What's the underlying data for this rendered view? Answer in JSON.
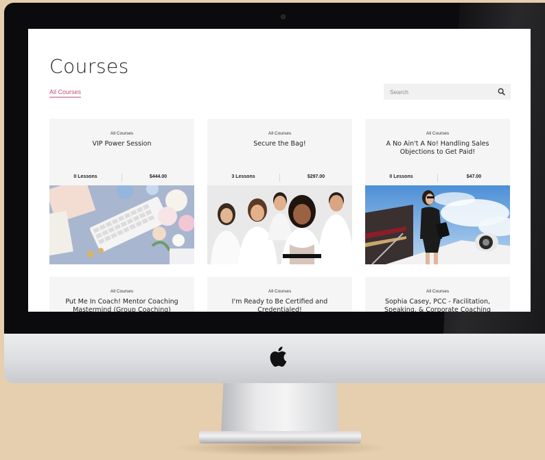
{
  "page": {
    "title": "Courses",
    "filter_tab": "All Courses",
    "search_placeholder": "Search"
  },
  "courses": [
    {
      "category": "All Courses",
      "title": "VIP Power Session",
      "lessons": "0 Lessons",
      "price": "$444.00",
      "image": "desk-flatlay-photo"
    },
    {
      "category": "All Courses",
      "title": "Secure the Bag!",
      "lessons": "3 Lessons",
      "price": "$297.00",
      "image": "team-group-photo"
    },
    {
      "category": "All Courses",
      "title": "A No Ain't A No! Handling Sales Objections to Get Paid!",
      "lessons": "0 Lessons",
      "price": "$47.00",
      "image": "jet-woman-photo"
    },
    {
      "category": "All Courses",
      "title": "Put Me In Coach! Mentor Coaching Mastermind (Group Coaching)"
    },
    {
      "category": "All Courses",
      "title": "I'm Ready to Be Certified and Credentialed!"
    },
    {
      "category": "All Courses",
      "title": "Sophia Casey, PCC - Facilitation, Speaking, & Corporate Coaching"
    }
  ],
  "colors": {
    "accent": "#c0527a",
    "card_bg": "#f5f5f5",
    "backdrop": "#e6cfae"
  },
  "icons": {
    "search": "magnifier",
    "brand": "apple-logo"
  }
}
